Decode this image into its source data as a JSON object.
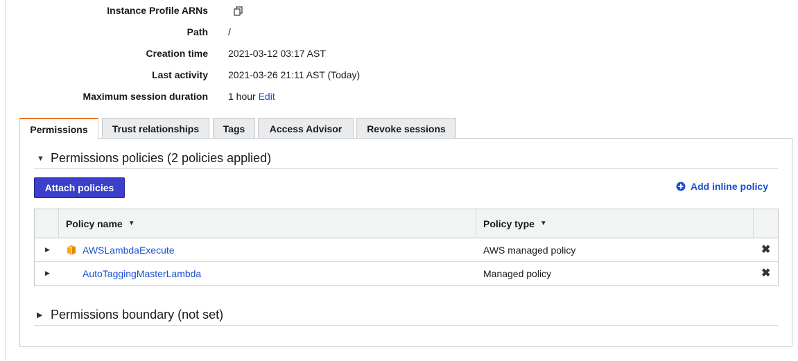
{
  "summary": {
    "rows": [
      {
        "key": "Instance Profile ARNs",
        "value": ""
      },
      {
        "key": "Path",
        "value": "/"
      },
      {
        "key": "Creation time",
        "value": "2021-03-12 03:17 AST"
      },
      {
        "key": "Last activity",
        "value": "2021-03-26 21:11 AST (Today)"
      },
      {
        "key": "Maximum session duration",
        "value": "1 hour",
        "link": "Edit"
      }
    ]
  },
  "tabs": [
    "Permissions",
    "Trust relationships",
    "Tags",
    "Access Advisor",
    "Revoke sessions"
  ],
  "active_tab": "Permissions",
  "permissions": {
    "section_title": "Permissions policies (2 policies applied)",
    "attach_button": "Attach policies",
    "add_inline": "Add inline policy",
    "table": {
      "headers": [
        "Policy name",
        "Policy type"
      ],
      "rows": [
        {
          "name": "AWSLambdaExecute",
          "type": "AWS managed policy",
          "icon": "aws-managed-cube-icon"
        },
        {
          "name": "AutoTaggingMasterLambda",
          "type": "Managed policy",
          "icon": ""
        }
      ]
    }
  },
  "boundary": {
    "section_title": "Permissions boundary (not set)"
  },
  "colors": {
    "accent_tab": "#ec7211",
    "primary_button": "#3b3fc9",
    "link": "#1a4fd1"
  }
}
